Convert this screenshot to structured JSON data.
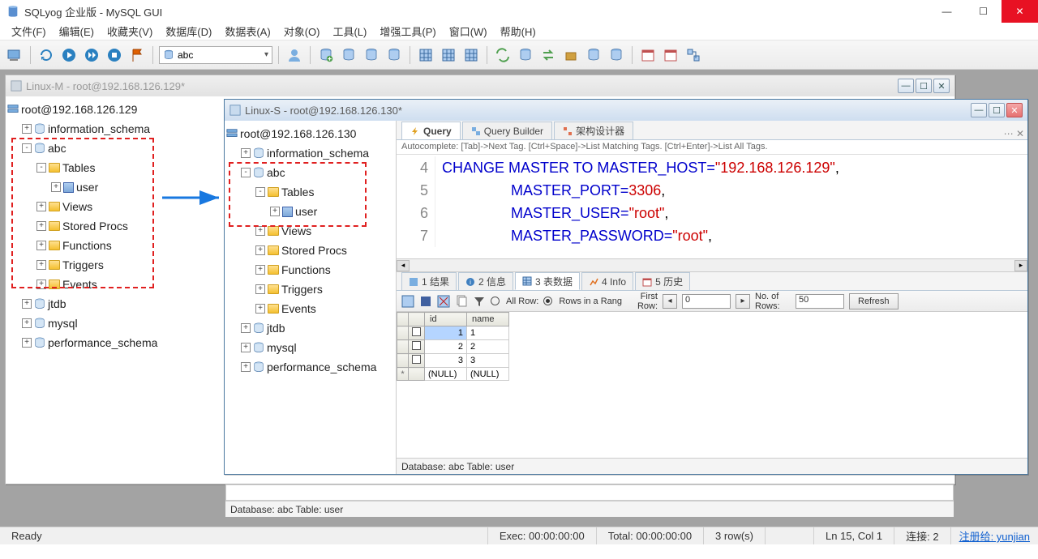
{
  "app_title": "SQLyog 企业版 - MySQL GUI",
  "menus": [
    "文件(F)",
    "编辑(E)",
    "收藏夹(V)",
    "数据库(D)",
    "数据表(A)",
    "对象(O)",
    "工具(L)",
    "增强工具(P)",
    "窗口(W)",
    "帮助(H)"
  ],
  "toolbar_combo": "abc",
  "mdi": {
    "win_m": {
      "title": "Linux-M - root@192.168.126.129*"
    },
    "win_s": {
      "title": "Linux-S - root@192.168.126.130*",
      "tree_root": "root@192.168.126.130",
      "tree": {
        "information_schema": "information_schema",
        "abc": "abc",
        "tables": "Tables",
        "user": "user",
        "views": "Views",
        "stored_procs": "Stored Procs",
        "functions": "Functions",
        "triggers": "Triggers",
        "events": "Events",
        "jtdb": "jtdb",
        "mysql": "mysql",
        "performance_schema": "performance_schema"
      },
      "tabs": {
        "query": "Query",
        "builder": "Query Builder",
        "schema": "架构设计器"
      },
      "autocomplete": "Autocomplete: [Tab]->Next Tag. [Ctrl+Space]->List Matching Tags. [Ctrl+Enter]->List All Tags.",
      "code": {
        "line_nums": [
          "4",
          "5",
          "6",
          "7"
        ],
        "l4a": "CHANGE MASTER TO",
        "l4b": " MASTER_HOST=",
        "l4c": "\"192.168.126.129\"",
        "l4d": ",",
        "l5_pad": "                 ",
        "l5a": "MASTER_PORT=",
        "l5b": "3306",
        "l5c": ",",
        "l6a": "MASTER_USER=",
        "l6b": "\"root\"",
        "l6c": ",",
        "l7a": "MASTER_PASSWORD=",
        "l7b": "\"root\"",
        "l7c": ","
      },
      "result_tabs": {
        "r1": "1 结果",
        "r2": "2 信息",
        "r3": "3 表数据",
        "r4": "4 Info",
        "r5": "5 历史"
      },
      "grid_toolbar": {
        "all_row": "All Row:",
        "rows_in_range": "Rows in a Rang",
        "first_row": "First Row:",
        "first_row_val": "0",
        "no_of_rows": "No. of Rows:",
        "no_of_rows_val": "50",
        "refresh": "Refresh"
      },
      "grid": {
        "headers": {
          "c0": "",
          "c1": "id",
          "c2": "name"
        },
        "rows": [
          {
            "sel": true,
            "id": "1",
            "name": "1"
          },
          {
            "sel": false,
            "id": "2",
            "name": "2"
          },
          {
            "sel": false,
            "id": "3",
            "name": "3"
          },
          {
            "sel": false,
            "id": "(NULL)",
            "name": "(NULL)",
            "star": true
          }
        ]
      },
      "cw_status": "Database: abc Table: user"
    }
  },
  "left_tree": {
    "root": "root@192.168.126.129",
    "information_schema": "information_schema",
    "abc": "abc",
    "tables": "Tables",
    "user": "user",
    "views": "Views",
    "stored_procs": "Stored Procs",
    "functions": "Functions",
    "triggers": "Triggers",
    "events": "Events",
    "jtdb": "jtdb",
    "mysql": "mysql",
    "performance_schema": "performance_schema"
  },
  "outer_status": "Database: abc Table: user",
  "status": {
    "ready": "Ready",
    "exec": "Exec: 00:00:00:00",
    "total": "Total: 00:00:00:00",
    "rows": "3 row(s)",
    "pos": "Ln 15, Col 1",
    "conn": "连接: 2",
    "reg": "注册给: yunjian"
  }
}
